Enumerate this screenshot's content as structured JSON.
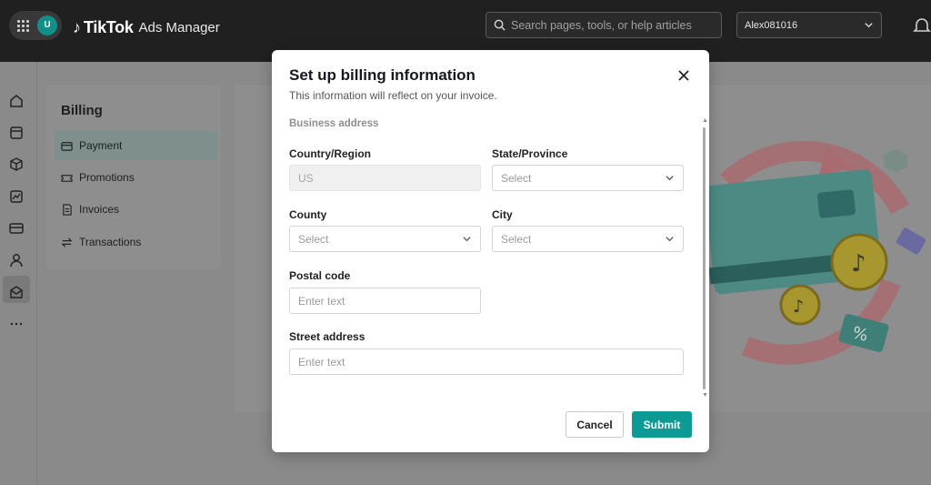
{
  "topbar": {
    "avatar_initial": "U",
    "brand_name": "TikTok",
    "brand_product": "Ads Manager",
    "search_placeholder": "Search pages, tools, or help articles",
    "account_name": "Alex081016"
  },
  "sidebar": {
    "title": "Billing",
    "items": [
      {
        "label": "Payment",
        "active": true
      },
      {
        "label": "Promotions",
        "active": false
      },
      {
        "label": "Invoices",
        "active": false
      },
      {
        "label": "Transactions",
        "active": false
      }
    ]
  },
  "modal": {
    "title": "Set up billing information",
    "subtitle": "This information will reflect on your invoice.",
    "section_label": "Business address",
    "fields": {
      "country": {
        "label": "Country/Region",
        "value": "US"
      },
      "state": {
        "label": "State/Province",
        "placeholder": "Select"
      },
      "county": {
        "label": "County",
        "placeholder": "Select"
      },
      "city": {
        "label": "City",
        "placeholder": "Select"
      },
      "postal": {
        "label": "Postal code",
        "placeholder": "Enter text"
      },
      "street": {
        "label": "Street address",
        "placeholder": "Enter text"
      }
    },
    "cancel_label": "Cancel",
    "submit_label": "Submit"
  },
  "colors": {
    "accent": "#0e9a94",
    "topbar": "#202020",
    "backdrop": "#8a8a8a"
  }
}
